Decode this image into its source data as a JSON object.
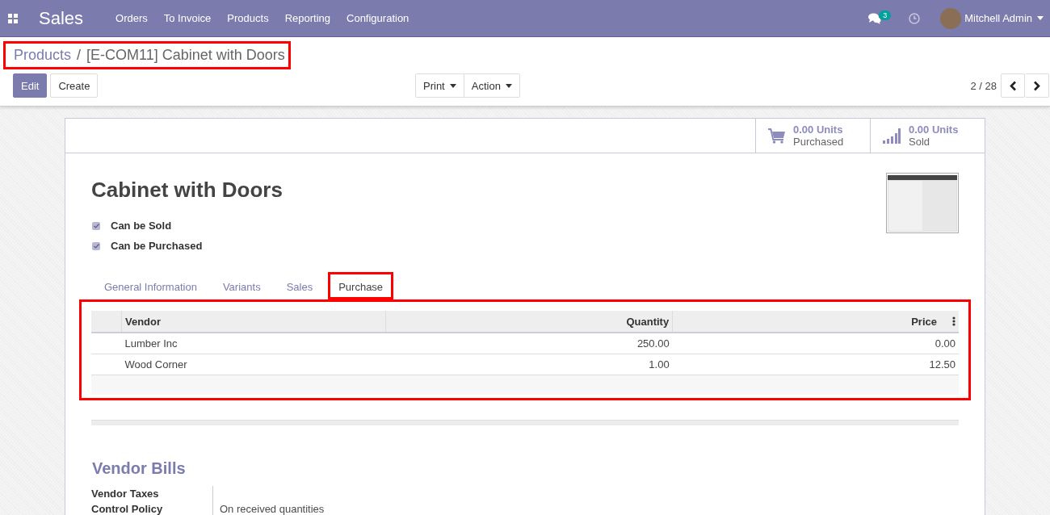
{
  "navbar": {
    "app_name": "Sales",
    "menu": [
      "Orders",
      "To Invoice",
      "Products",
      "Reporting",
      "Configuration"
    ],
    "messages_badge": "3",
    "user_name": "Mitchell Admin"
  },
  "breadcrumb": {
    "parent": "Products",
    "separator": "/",
    "current": "[E-COM11] Cabinet with Doors",
    "highlighted": true
  },
  "buttons": {
    "edit": "Edit",
    "create": "Create",
    "print": "Print",
    "action": "Action"
  },
  "pager": "2 / 28",
  "stat_buttons": [
    {
      "kind": "cart",
      "value": "0.00 Units",
      "label": "Purchased"
    },
    {
      "kind": "bars",
      "value": "0.00 Units",
      "label": "Sold"
    }
  ],
  "product": {
    "name": "Cabinet with Doors",
    "options": [
      {
        "label": "Can be Sold",
        "checked": true
      },
      {
        "label": "Can be Purchased",
        "checked": true
      }
    ]
  },
  "tabs": [
    {
      "label": "General Information",
      "selected": false,
      "highlighted": false
    },
    {
      "label": "Variants",
      "selected": false,
      "highlighted": false
    },
    {
      "label": "Sales",
      "selected": false,
      "highlighted": false
    },
    {
      "label": "Purchase",
      "selected": true,
      "highlighted": true
    }
  ],
  "vendor_table": {
    "highlighted": true,
    "columns": [
      "Vendor",
      "Quantity",
      "Price"
    ],
    "rows": [
      [
        "Lumber Inc",
        "250.00",
        "0.00"
      ],
      [
        "Wood Corner",
        "1.00",
        "12.50"
      ]
    ]
  },
  "vendor_bills": {
    "title": "Vendor Bills",
    "fields": [
      {
        "label": "Vendor Taxes"
      },
      {
        "label": "Control Policy",
        "value": "On received quantities"
      }
    ]
  }
}
